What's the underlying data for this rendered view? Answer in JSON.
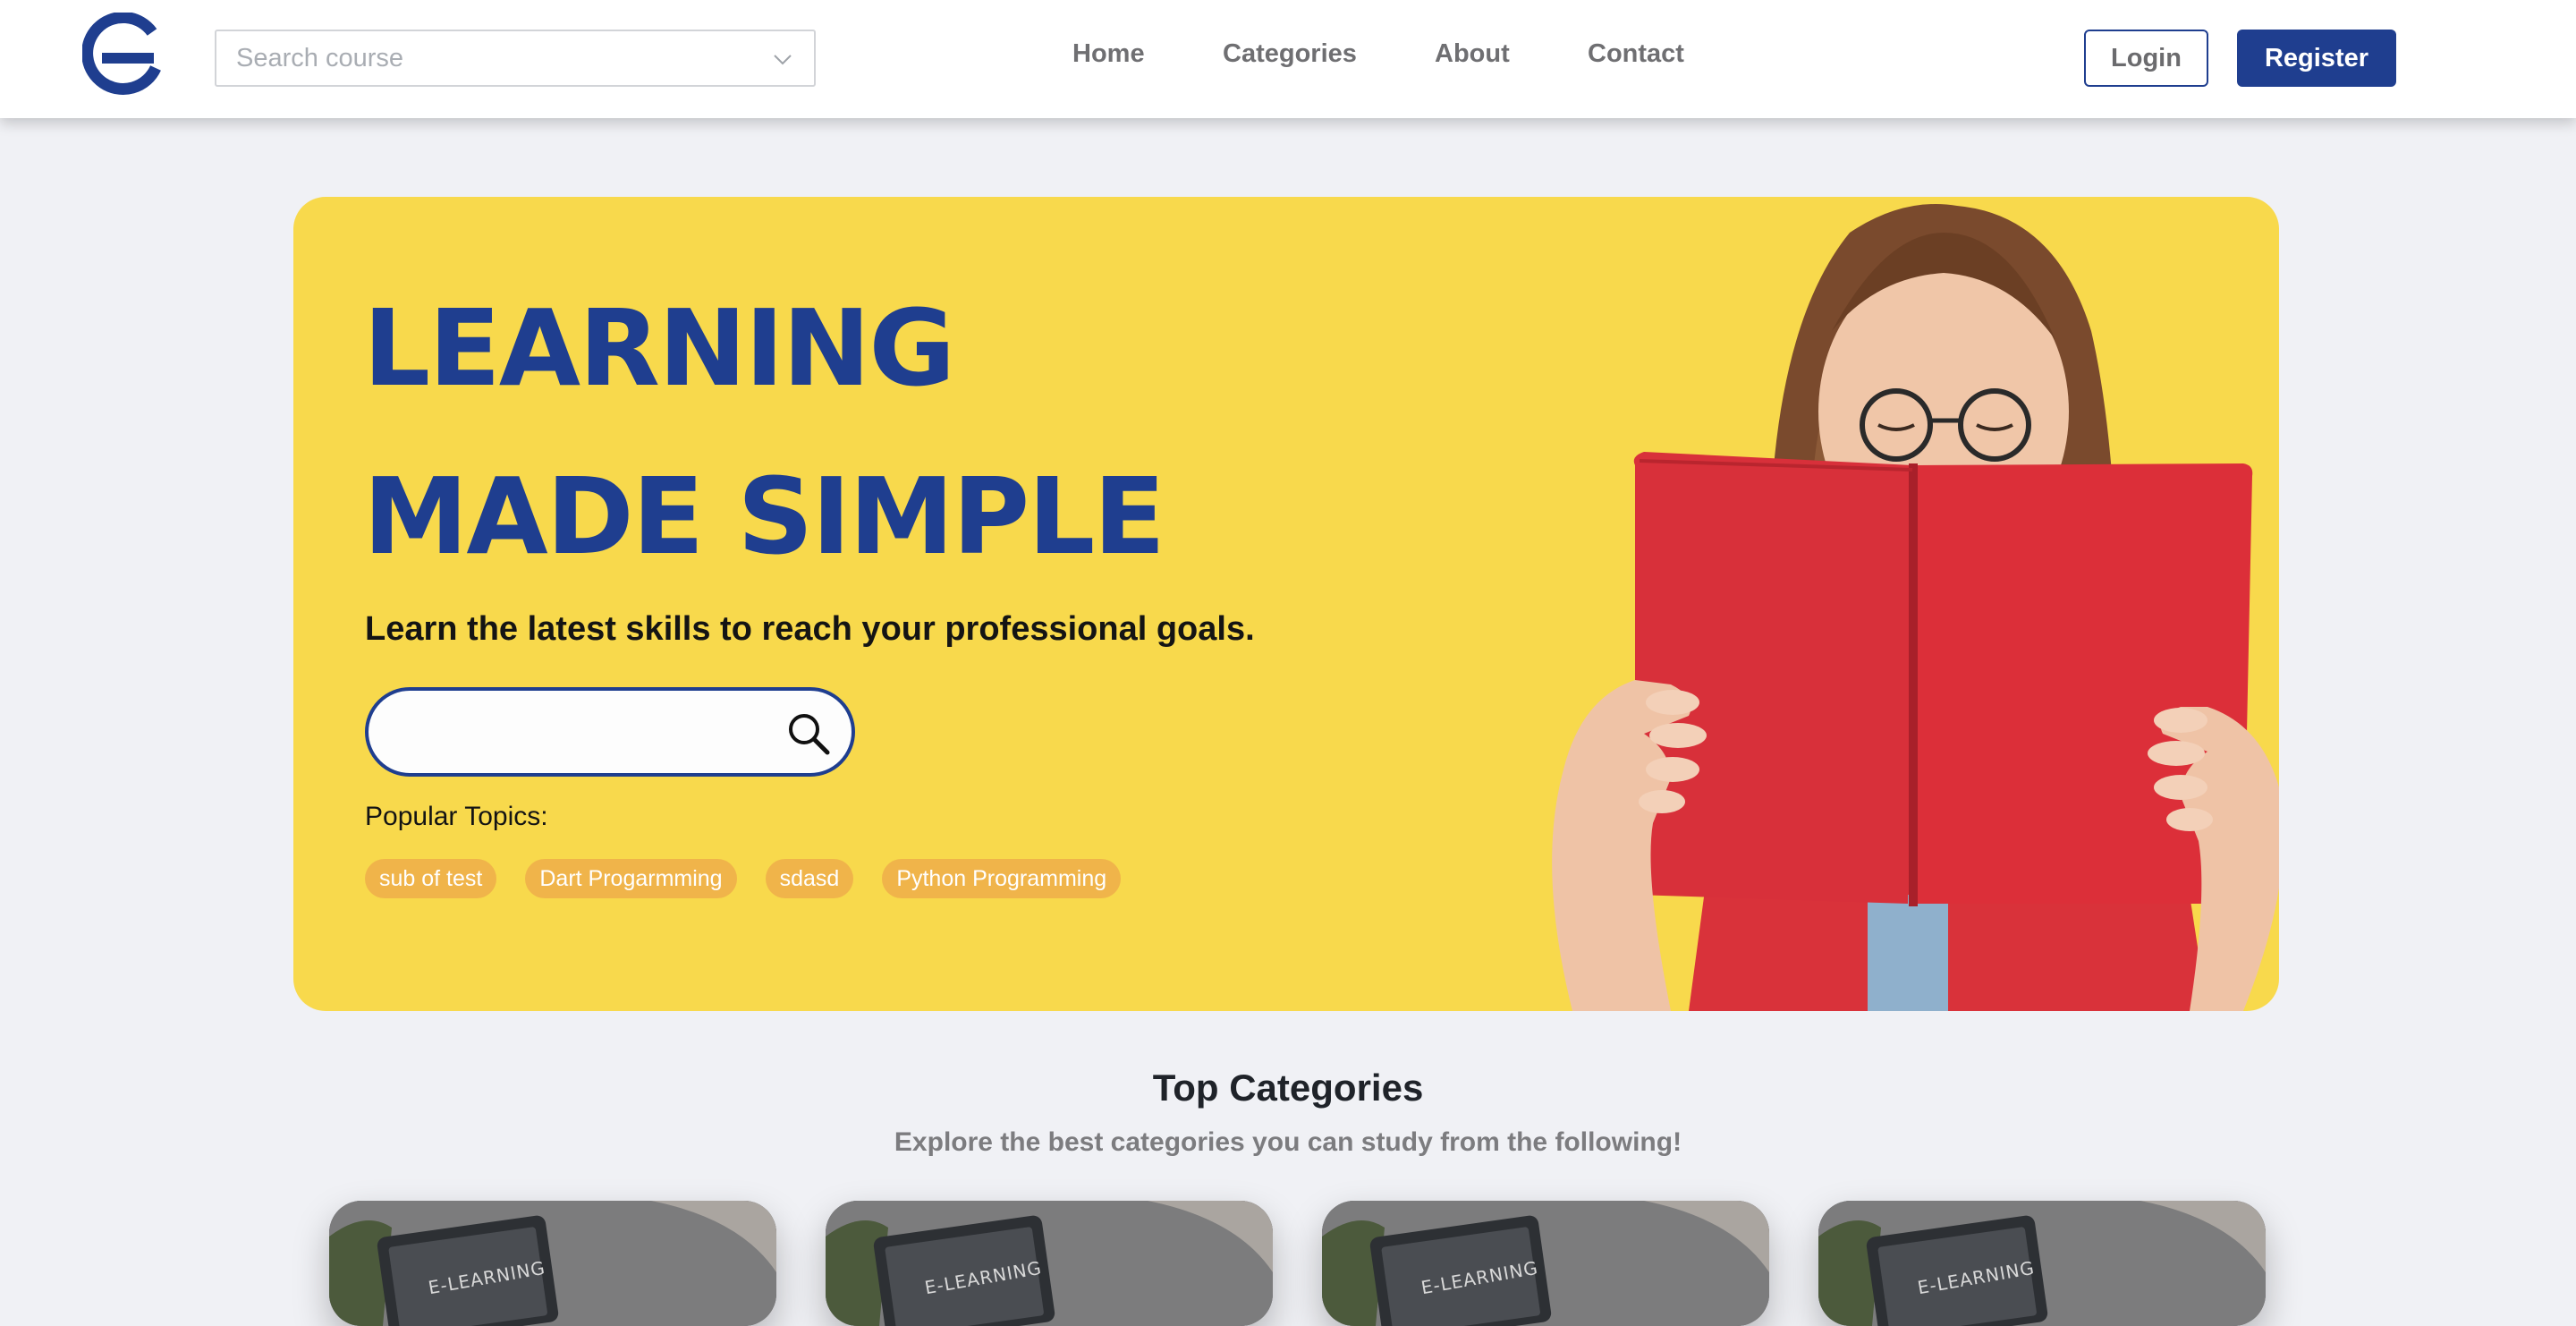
{
  "header": {
    "search_placeholder": "Search course",
    "nav": [
      {
        "label": "Home"
      },
      {
        "label": "Categories"
      },
      {
        "label": "About"
      },
      {
        "label": "Contact"
      }
    ],
    "login_label": "Login",
    "register_label": "Register"
  },
  "hero": {
    "title_line1": "LEARNING",
    "title_line2": "MADE SIMPLE",
    "subtitle": "Learn the latest skills to reach your professional goals.",
    "search_value": "",
    "popular_label": "Popular Topics:",
    "topics": [
      "sub of test",
      "Dart Progarmming",
      "sdasd",
      "Python Programming"
    ]
  },
  "categories": {
    "title": "Top Categories",
    "subtitle": "Explore the best categories you can study from the following!",
    "cards": [
      {
        "image_text": "E-LEARNING"
      },
      {
        "image_text": "E-LEARNING"
      },
      {
        "image_text": "E-LEARNING"
      },
      {
        "image_text": "E-LEARNING"
      }
    ]
  },
  "colors": {
    "brand_blue": "#1f3e8f",
    "hero_yellow": "#f8d94c",
    "chip_orange": "#f0b44a",
    "page_bg": "#f0f1f5"
  }
}
